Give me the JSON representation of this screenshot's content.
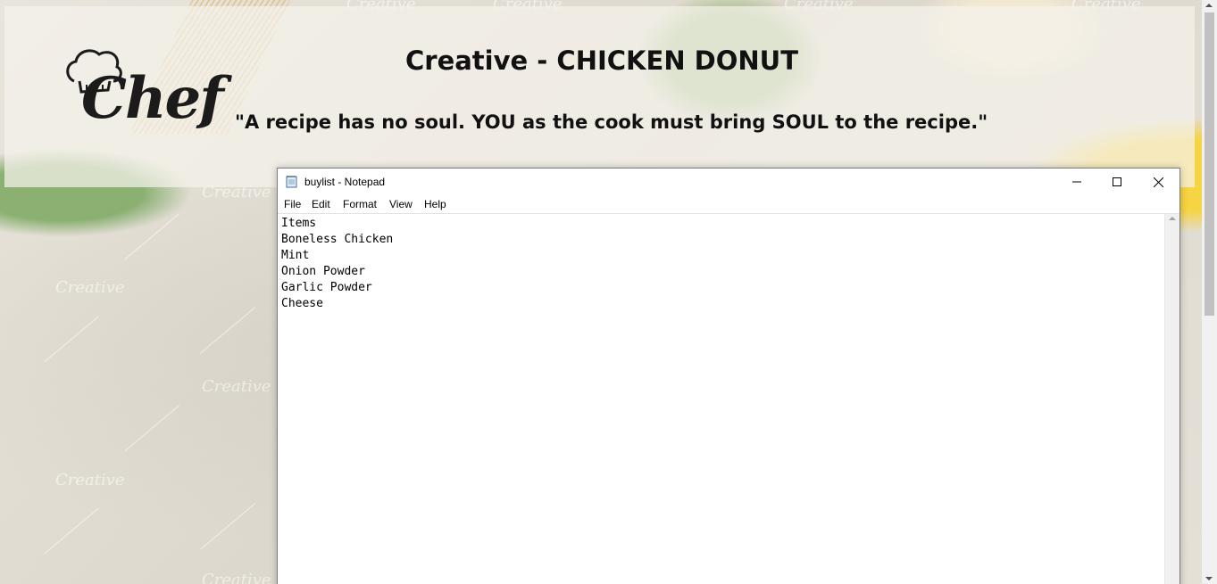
{
  "banner": {
    "logo_text": "Chef",
    "title": "Creative - CHICKEN DONUT",
    "quote": "\"A recipe has no soul. YOU as the cook must bring SOUL to the recipe.\""
  },
  "background": {
    "watermark": "Creative"
  },
  "notepad": {
    "title": "buylist - Notepad",
    "menu": [
      "File",
      "Edit",
      "Format",
      "View",
      "Help"
    ],
    "lines": [
      "Items",
      "Boneless Chicken",
      "Mint",
      "Onion Powder",
      "Garlic Powder",
      "Cheese"
    ]
  }
}
